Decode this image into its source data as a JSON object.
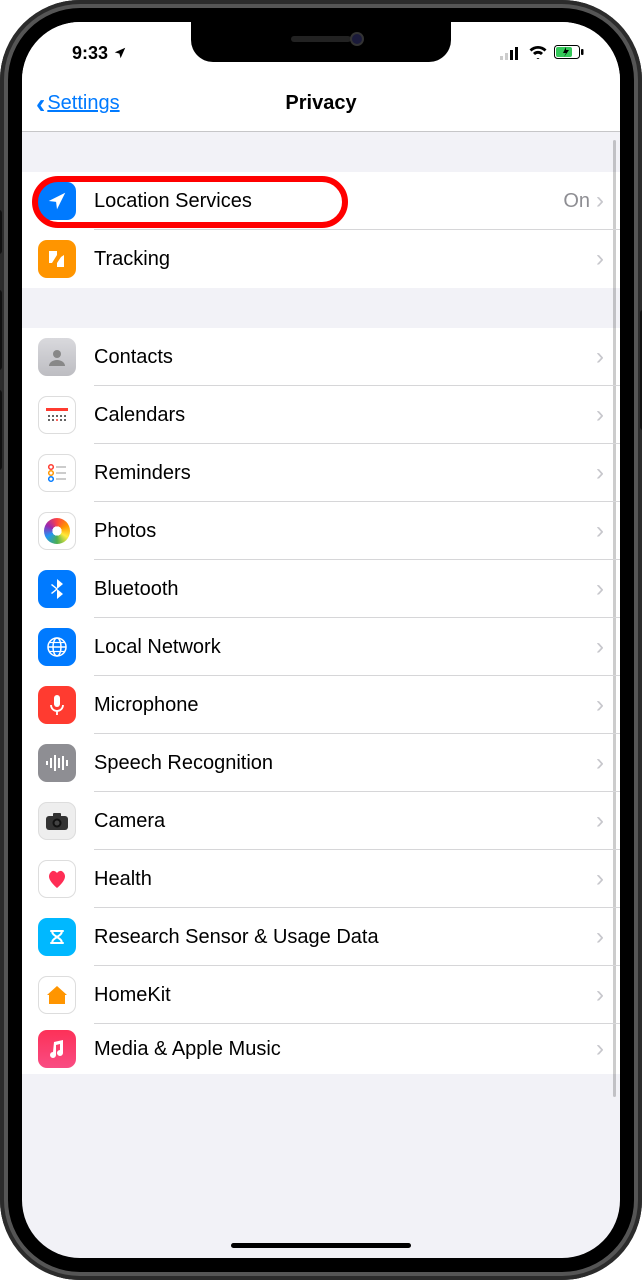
{
  "status": {
    "time": "9:33",
    "location_arrow": true
  },
  "nav": {
    "back_label": "Settings",
    "title": "Privacy"
  },
  "section1": [
    {
      "id": "location",
      "label": "Location Services",
      "value": "On",
      "icon": "location-arrow-icon",
      "icon_bg": "bg-blue",
      "highlight": true
    },
    {
      "id": "tracking",
      "label": "Tracking",
      "value": "",
      "icon": "tracking-icon",
      "icon_bg": "bg-orange"
    }
  ],
  "section2": [
    {
      "id": "contacts",
      "label": "Contacts",
      "icon": "contacts-icon",
      "icon_bg": "contacts-bg"
    },
    {
      "id": "calendars",
      "label": "Calendars",
      "icon": "calendar-icon",
      "icon_bg": "calendars-bg"
    },
    {
      "id": "reminders",
      "label": "Reminders",
      "icon": "reminders-icon",
      "icon_bg": "reminders-bg"
    },
    {
      "id": "photos",
      "label": "Photos",
      "icon": "photos-icon",
      "icon_bg": "photos-grad"
    },
    {
      "id": "bluetooth",
      "label": "Bluetooth",
      "icon": "bluetooth-icon",
      "icon_bg": "bg-blue"
    },
    {
      "id": "localnetwork",
      "label": "Local Network",
      "icon": "globe-icon",
      "icon_bg": "bg-blue"
    },
    {
      "id": "microphone",
      "label": "Microphone",
      "icon": "mic-icon",
      "icon_bg": "bg-red"
    },
    {
      "id": "speech",
      "label": "Speech Recognition",
      "icon": "waveform-icon",
      "icon_bg": "bg-gray"
    },
    {
      "id": "camera",
      "label": "Camera",
      "icon": "camera-icon",
      "icon_bg": "bg-grayd"
    },
    {
      "id": "health",
      "label": "Health",
      "icon": "heart-icon",
      "icon_bg": "bg-white"
    },
    {
      "id": "research",
      "label": "Research Sensor & Usage Data",
      "icon": "research-icon",
      "icon_bg": "bg-cyan"
    },
    {
      "id": "homekit",
      "label": "HomeKit",
      "icon": "home-icon",
      "icon_bg": "bg-housy"
    },
    {
      "id": "media",
      "label": "Media & Apple Music",
      "icon": "music-icon",
      "icon_bg": "bg-pink"
    }
  ]
}
